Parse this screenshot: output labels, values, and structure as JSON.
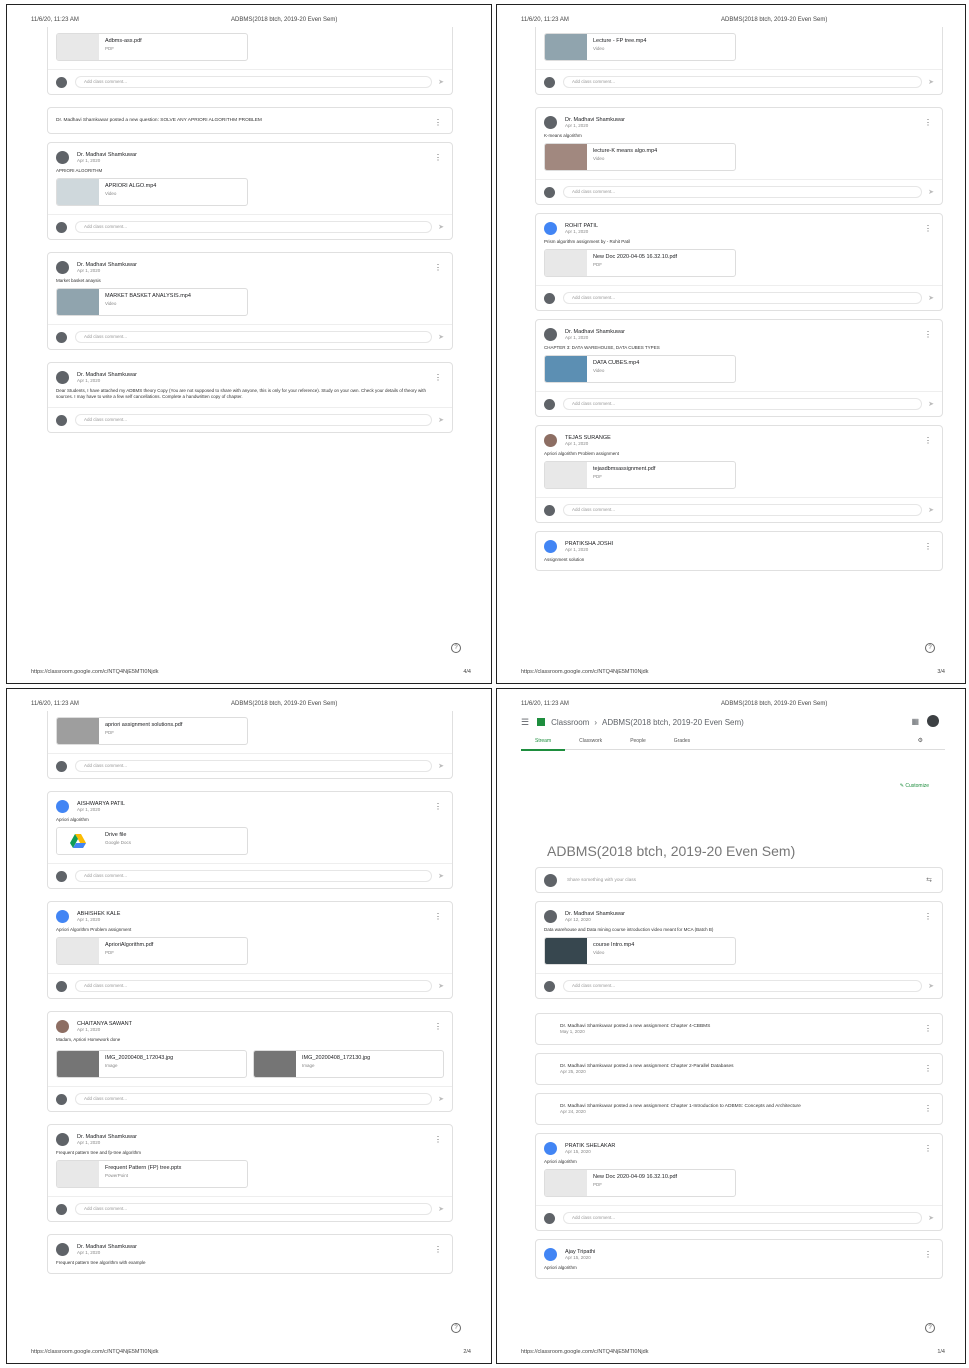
{
  "header": {
    "date": "11/6/20, 11:23 AM",
    "course": "ADBMS(2018 btch, 2019-20 Even Sem)"
  },
  "footer": {
    "url": "https://classroom.google.com/c/NTQ4NjE5MTI0Njdk"
  },
  "p1": {
    "page_num": "4/4",
    "top_file": {
      "name": "Adbms-ass.pdf",
      "type": "PDF"
    },
    "comment_placeholder": "Add class comment...",
    "question": "Dr. Madhavi Shamkuwar posted a new question: SOLVE ANY APRIORI ALGORITHM PROBLEM",
    "posts": [
      {
        "author": "Dr. Madhavi Shamkuwar",
        "date": "Apr 1, 2020",
        "body": "APRIORI ALGORITHM",
        "file": "APRIORI ALGO.mp4",
        "type": "Video"
      },
      {
        "author": "Dr. Madhavi Shamkuwar",
        "date": "Apr 1, 2020",
        "body": "Market basket anaysis",
        "file": "MARKET BASKET ANALYSIS.mp4",
        "type": "Video"
      },
      {
        "author": "Dr. Madhavi Shamkuwar",
        "date": "Apr 1, 2020",
        "body": "Dear Students, I have attached my ADBMS theory Copy (You are not supposed to share with anyone, this is only for your reference). Study on your own. Check your details of theory with sources. I may have to write a few self cancellations. Complete a handwritten copy of chapter."
      }
    ]
  },
  "p2": {
    "page_num": "3/4",
    "top_file": {
      "name": "Lecture - FP tree.mp4",
      "type": "Video"
    },
    "posts": [
      {
        "author": "Dr. Madhavi Shamkuwar",
        "date": "Apr 1, 2020",
        "body": "K-means algorithm",
        "file": "lecture-K means algo.mp4",
        "type": "Video"
      },
      {
        "author": "ROHIT PATIL",
        "date": "Apr 1, 2020",
        "body": "Prism algorithm assignment by - Rohit Patil",
        "file": "New Doc 2020-04-05 16.32.10.pdf",
        "type": "PDF"
      },
      {
        "author": "Dr. Madhavi Shamkuwar",
        "date": "Apr 1, 2020",
        "body": "CHAPTER 3: DATA WAREHOUSE, DATA CUBES TYPES",
        "file": "DATA CUBES.mp4",
        "type": "Video"
      },
      {
        "author": "TEJAS SURANGE",
        "date": "Apr 1, 2020",
        "body": "Apriori algorithm Problem assignment",
        "file": "tejasdbmsassignment.pdf",
        "type": "PDF"
      },
      {
        "author": "PRATIKSHA JOSHI",
        "date": "Apr 1, 2020",
        "body": "Assignment solution"
      }
    ]
  },
  "p3": {
    "page_num": "2/4",
    "top_file": {
      "name": "apriori assignment solutions.pdf",
      "type": "PDF"
    },
    "posts": [
      {
        "author": "AISHWARYA PATIL",
        "date": "Apr 1, 2020",
        "body": "Apriori algorithm",
        "file": "Drive file",
        "type": "Google Docs"
      },
      {
        "author": "ABHISHEK KALE",
        "date": "Apr 1, 2020",
        "body": "Apriori Algorithm Problem assignment",
        "file": "AprioriAlgorithm.pdf",
        "type": "PDF"
      },
      {
        "author": "CHAITANYA SAWANT",
        "date": "Apr 1, 2020",
        "body": "Madam, Apriori Homework done",
        "file": "IMG_20200408_172043.jpg",
        "type": "Image",
        "file2": "IMG_20200408_172130.jpg"
      },
      {
        "author": "Dr. Madhavi Shamkuwar",
        "date": "Apr 1, 2020",
        "body": "Frequent pattern tree and fp-tree algorithm",
        "file": "Frequent Pattern (FP) tree.pptx",
        "type": "PowerPoint"
      },
      {
        "author": "Dr. Madhavi Shamkuwar",
        "date": "Apr 1, 2020",
        "body": "Frequent pattern tree algorithm with example"
      }
    ]
  },
  "p4": {
    "page_num": "1/4",
    "nav": {
      "menu": "☰",
      "app": "Classroom",
      "sep": "›",
      "course": "ADBMS(2018 btch, 2019-20 Even Sem)"
    },
    "tabs": [
      "Stream",
      "Classwork",
      "People",
      "Grades"
    ],
    "customize": "Customize",
    "big_title": "ADBMS(2018 btch, 2019-20 Even Sem)",
    "announce_placeholder": "Share something with your class",
    "posts": [
      {
        "author": "Dr. Madhavi Shamkuwar",
        "date": "Apr 12, 2020",
        "body": "Data warehouse and Data mining course introduction video meant for MCA (Batch B)",
        "file": "course Intro.mp4",
        "type": "Video"
      }
    ],
    "assignments": [
      {
        "text": "Dr. Madhavi Shamkuwar posted a new assignment: Chapter 4-CBBMS",
        "date": "May 1, 2020"
      },
      {
        "text": "Dr. Madhavi Shamkuwar posted a new assignment: Chapter 2-Parallel Databases",
        "date": "Apr 25, 2020"
      },
      {
        "text": "Dr. Madhavi Shamkuwar posted a new assignment: Chapter 1-Introduction to ADBMS: Concepts and Architecture",
        "date": "Apr 24, 2020"
      }
    ],
    "posts2": [
      {
        "author": "PRATIK SHELAKAR",
        "date": "Apr 15, 2020",
        "body": "Apriori algorithm",
        "file": "New Doc 2020-04-09 16.32.10.pdf",
        "type": "PDF"
      },
      {
        "author": "Ajay Tripathi",
        "date": "Apr 15, 2020",
        "body": "Apriori algorithm"
      }
    ]
  }
}
